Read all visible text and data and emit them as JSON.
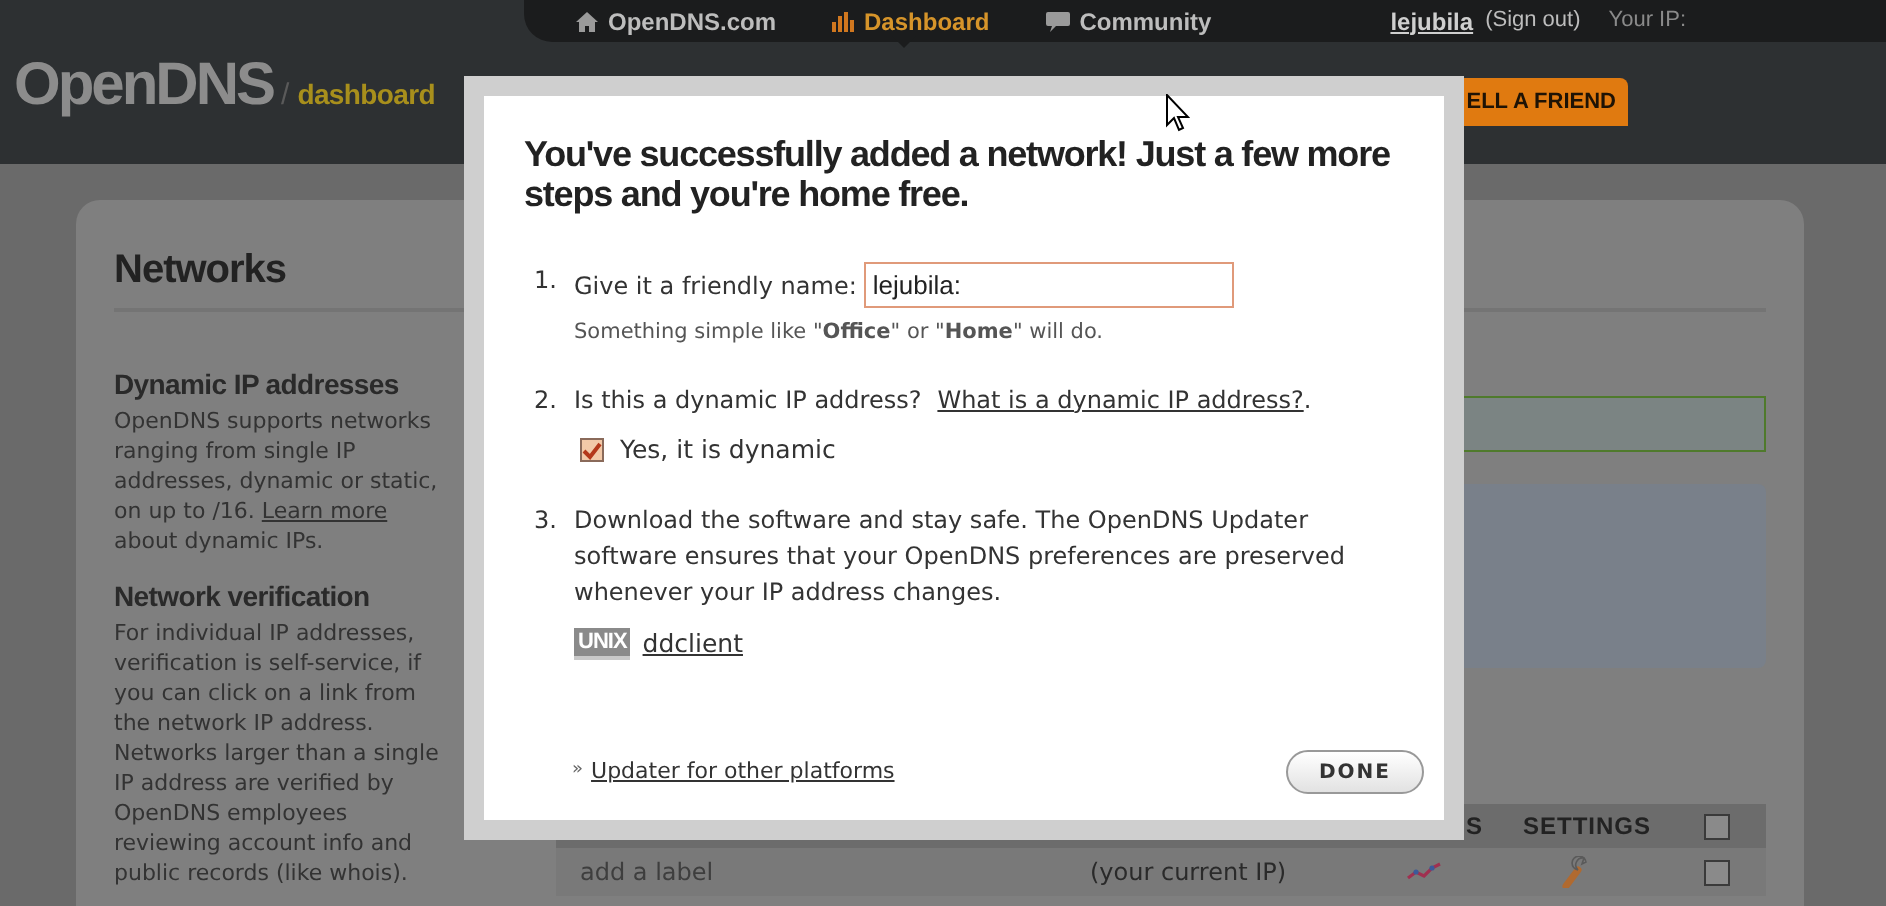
{
  "top_nav": {
    "items": [
      {
        "label": "OpenDNS.com",
        "selected": false
      },
      {
        "label": "Dashboard",
        "selected": true
      },
      {
        "label": "Community",
        "selected": false
      }
    ],
    "user": "lejubila",
    "sign_out": "(Sign out)",
    "ip_label": "Your IP:"
  },
  "header": {
    "logo": "OpenDNS",
    "divider": "/",
    "section": "dashboard",
    "tell_friend": "ELL A FRIEND"
  },
  "sidebar": {
    "title": "Networks",
    "sections": [
      {
        "heading": "Dynamic IP addresses",
        "text": "OpenDNS supports networks ranging from single IP addresses, dynamic or static, on up to /16.",
        "link": "Learn more",
        "after": "about dynamic IPs."
      },
      {
        "heading": "Network verification",
        "text": "For individual IP addresses, verification is self-service, if you can click on a link from the network IP address. Networks larger than a single IP address are verified by OpenDNS employees reviewing account info and public records (like whois)."
      }
    ]
  },
  "table": {
    "columns": [
      "S",
      "SETTINGS"
    ],
    "header_checked": false,
    "rows": [
      {
        "label_placeholder": "add a label",
        "ip_note": "(your current IP)",
        "checked": false
      }
    ]
  },
  "dialog": {
    "title": "You've successfully added a network! Just a few more steps and you're home free.",
    "steps": [
      {
        "kind": "name",
        "number": "1.",
        "text": "Give it a friendly name:",
        "value": "lejubila:",
        "hint": "Something simple like \"**Office**\" or \"**Home**\" will do."
      },
      {
        "kind": "dynamic",
        "number": "2.",
        "text": "Is this a dynamic IP address?",
        "link": "What is a dynamic IP address?",
        "after": ".",
        "checkbox_label": "Yes, it is dynamic",
        "checked": true
      },
      {
        "kind": "download",
        "number": "3.",
        "text": "Download the software and stay safe. The OpenDNS Updater software ensures that your OpenDNS preferences are preserved whenever your IP address changes.",
        "badge": "UNIX",
        "link": "ddclient"
      }
    ],
    "footer_mark": "»",
    "footer_link": "Updater for other platforms",
    "done": "DONE"
  }
}
